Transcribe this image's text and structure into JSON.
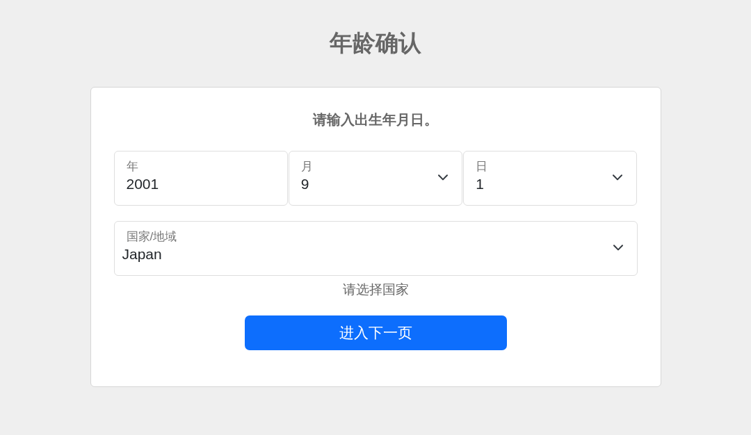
{
  "page": {
    "title": "年龄确认"
  },
  "form": {
    "prompt": "请输入出生年月日。",
    "date_fields": [
      {
        "kind": "input",
        "label": "年",
        "value": "2001"
      },
      {
        "kind": "select",
        "label": "月",
        "value": "9"
      },
      {
        "kind": "select",
        "label": "日",
        "value": "1"
      }
    ],
    "country_field": {
      "kind": "select",
      "label": "国家/地域",
      "value": "Japan"
    },
    "hint": "请选择国家",
    "submit_button": "进入下一页"
  }
}
